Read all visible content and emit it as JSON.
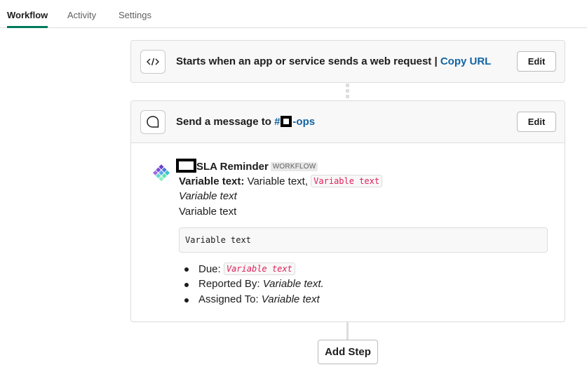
{
  "tabs": [
    {
      "label": "Workflow",
      "active": true
    },
    {
      "label": "Activity",
      "active": false
    },
    {
      "label": "Settings",
      "active": false
    }
  ],
  "trigger_step": {
    "icon": "code-icon",
    "text": "Starts when an app or service sends a web request |",
    "link": "Copy URL",
    "edit_label": "Edit"
  },
  "message_step": {
    "icon": "message-bubble-icon",
    "text_prefix": "Send a message to",
    "channel_hash": "#",
    "channel_suffix": "-ops",
    "edit_label": "Edit"
  },
  "preview": {
    "sender_name": "SLA Reminder",
    "badge": "WORKFLOW",
    "line1_bold": "Variable text:",
    "line1_plain": "Variable text,",
    "line1_code": "Variable text",
    "line2_italic": "Variable text",
    "line3": "Variable text",
    "code_block": "Variable text",
    "bullets": {
      "due_label": "Due:",
      "due_value": "Variable text",
      "reported_label": "Reported By:",
      "reported_value": "Variable text.",
      "assigned_label": "Assigned To:",
      "assigned_value": "Variable text"
    }
  },
  "add_step_label": "Add Step",
  "colors": {
    "accent": "#007a5a",
    "link": "#1264a3",
    "code": "#e01e5a"
  }
}
